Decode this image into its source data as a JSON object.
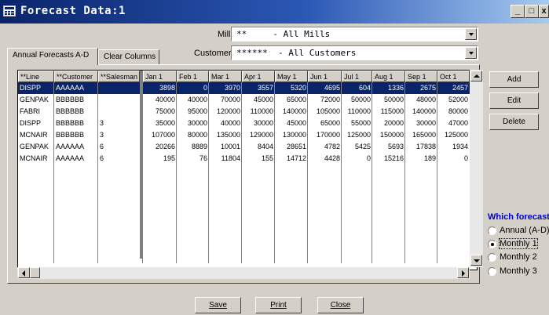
{
  "window": {
    "title": "Forecast Data:1",
    "controls": {
      "minimize": "_",
      "maximize": "□",
      "close": "x"
    }
  },
  "filters": {
    "mill": {
      "label": "Mill",
      "value": "**     - All Mills"
    },
    "customer": {
      "label": "Customer",
      "value": "******  - All Customers"
    }
  },
  "tabs": [
    {
      "label": "Annual Forecasts A-D",
      "active": true
    },
    {
      "label": "Clear Columns",
      "active": false
    }
  ],
  "grid": {
    "columns": [
      "**Line",
      "**Customer",
      "**Salesman",
      "Jan 1",
      "Feb 1",
      "Mar 1",
      "Apr 1",
      "May 1",
      "Jun 1",
      "Jul 1",
      "Aug 1",
      "Sep 1",
      "Oct 1"
    ],
    "rows": [
      {
        "selected": true,
        "cells": [
          "DISPP",
          "AAAAAA",
          "",
          "3898",
          "0",
          "3970",
          "3557",
          "5320",
          "4695",
          "604",
          "1336",
          "2675",
          "2457"
        ]
      },
      {
        "selected": false,
        "cells": [
          "GENPAK",
          "BBBBBB",
          "",
          "40000",
          "40000",
          "70000",
          "45000",
          "65000",
          "72000",
          "50000",
          "50000",
          "48000",
          "52000"
        ]
      },
      {
        "selected": false,
        "cells": [
          "FABRI",
          "BBBBBB",
          "",
          "75000",
          "95000",
          "120000",
          "110000",
          "140000",
          "105000",
          "110000",
          "115000",
          "140000",
          "80000"
        ]
      },
      {
        "selected": false,
        "cells": [
          "DISPP",
          "BBBBBB",
          "3",
          "35000",
          "30000",
          "40000",
          "30000",
          "45000",
          "65000",
          "55000",
          "20000",
          "30000",
          "47000"
        ]
      },
      {
        "selected": false,
        "cells": [
          "MCNAIR",
          "BBBBBB",
          "3",
          "107000",
          "80000",
          "135000",
          "129000",
          "130000",
          "170000",
          "125000",
          "150000",
          "165000",
          "125000"
        ]
      },
      {
        "selected": false,
        "cells": [
          "GENPAK",
          "AAAAAA",
          "6",
          "20266",
          "8889",
          "10001",
          "8404",
          "28651",
          "4782",
          "5425",
          "5693",
          "17838",
          "1934"
        ]
      },
      {
        "selected": false,
        "cells": [
          "MCNAIR",
          "AAAAAA",
          "6",
          "195",
          "76",
          "11804",
          "155",
          "14712",
          "4428",
          "0",
          "15216",
          "189",
          "0"
        ]
      }
    ]
  },
  "side_buttons": {
    "add": "Add",
    "edit": "Edit",
    "delete": "Delete"
  },
  "forecast": {
    "heading": "Which forecast",
    "options": [
      "Annual (A-D)",
      "Monthly 1",
      "Monthly 2",
      "Monthly 3"
    ],
    "selected": "Monthly 1"
  },
  "bottom_buttons": {
    "save": "Save",
    "print": "Print",
    "close": "Close"
  }
}
